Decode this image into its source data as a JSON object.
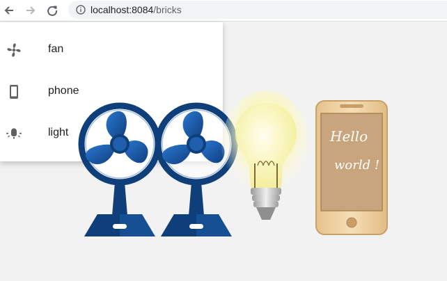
{
  "browser": {
    "url_host": "localhost:8084",
    "url_path": "/bricks",
    "back_icon": "arrow-left-icon",
    "forward_icon": "arrow-right-icon",
    "reload_icon": "reload-icon",
    "site_info_icon": "info-icon"
  },
  "menu": {
    "items": [
      {
        "label": "fan",
        "icon": "fan-icon"
      },
      {
        "label": "phone",
        "icon": "smartphone-icon"
      },
      {
        "label": "light",
        "icon": "lightbulb-icon"
      }
    ]
  },
  "bricks": [
    {
      "type": "fan"
    },
    {
      "type": "fan"
    },
    {
      "type": "light"
    },
    {
      "type": "phone",
      "screen_text_line1": "Hello",
      "screen_text_line2": "world !"
    }
  ],
  "colors": {
    "fan_blue_dark": "#0e3f7a",
    "fan_blue": "#1f63b5",
    "phone_body": "#f0d3a3",
    "phone_screen": "#c8a57c",
    "bulb_glow": "#fbf7b9"
  }
}
